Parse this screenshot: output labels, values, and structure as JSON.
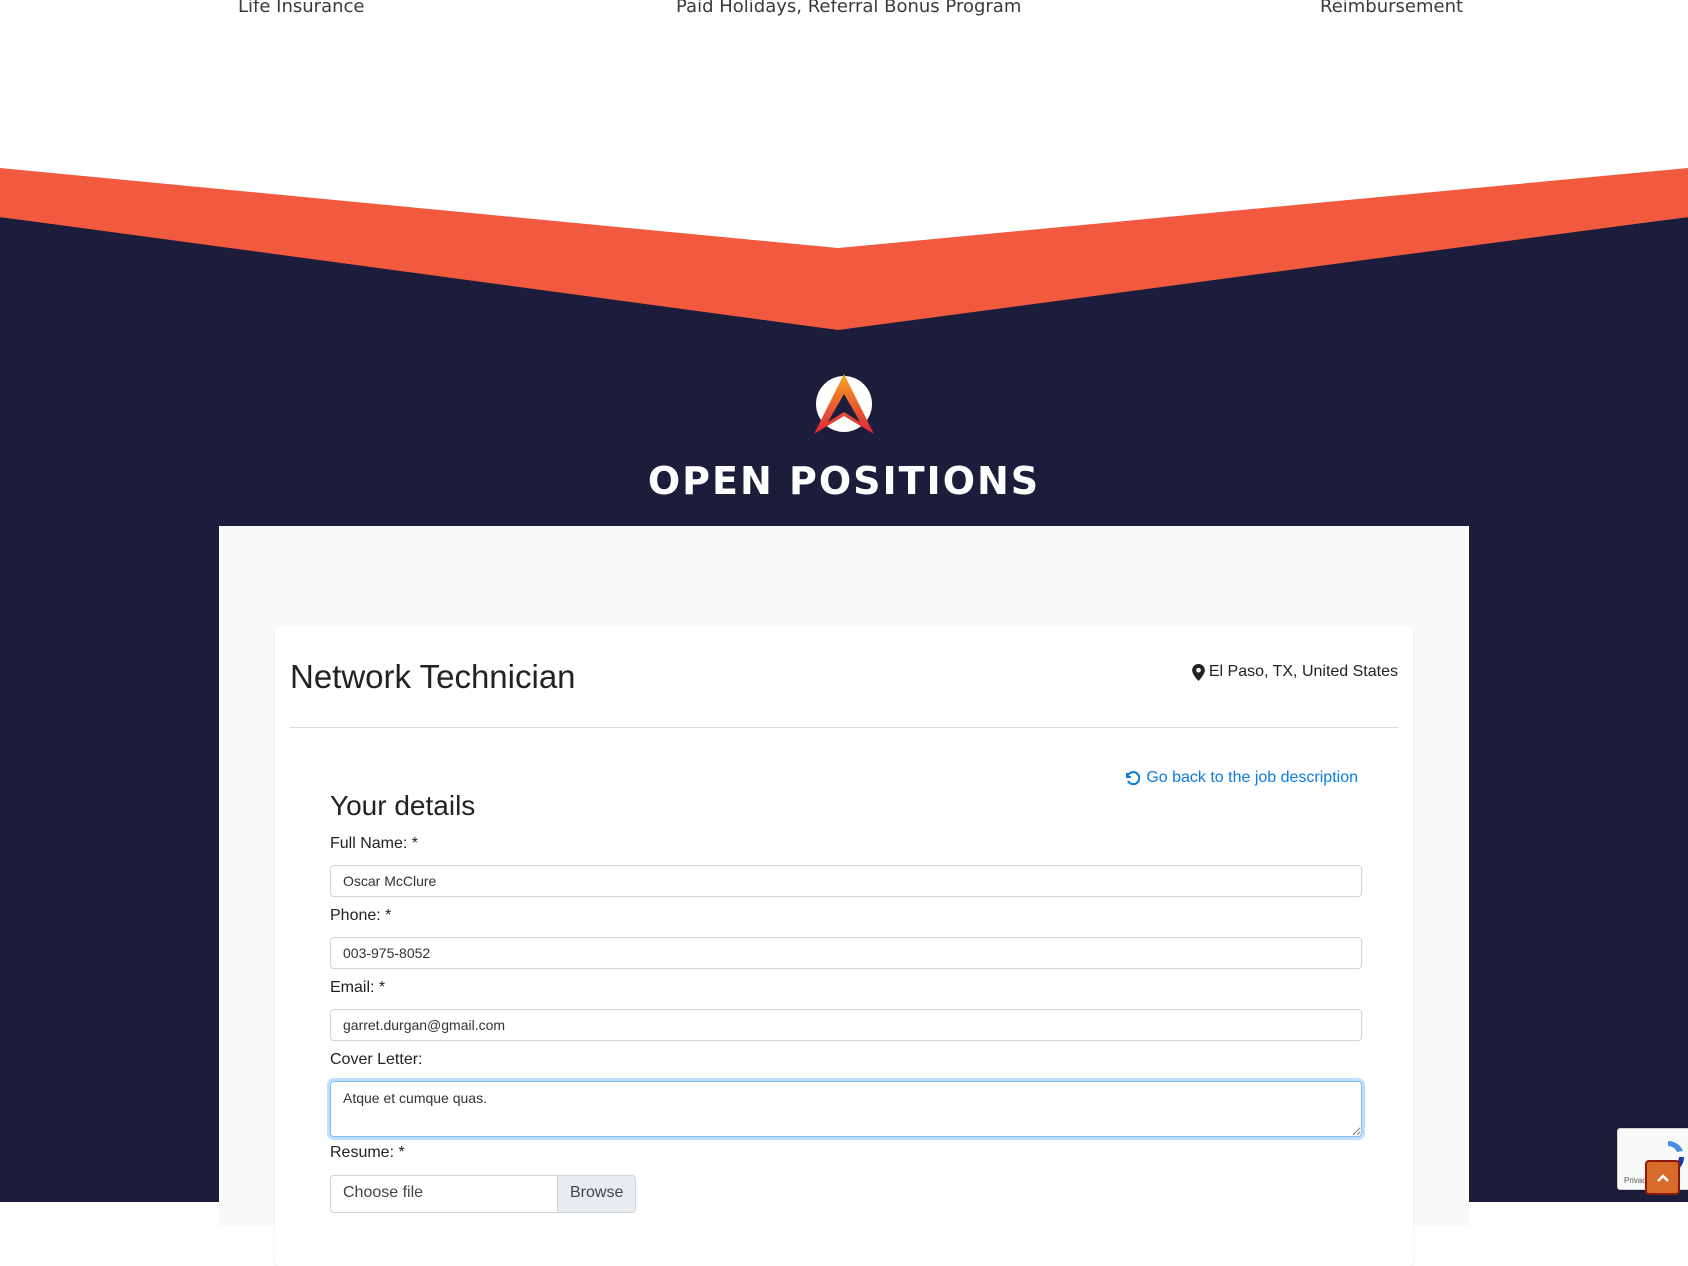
{
  "benefits": [
    "Life Insurance",
    "Paid Holidays, Referral Bonus Program",
    "Reimbursement"
  ],
  "section_title": "OPEN POSITIONS",
  "colors": {
    "accent": "#f25a3f",
    "navy": "#1b1d3b",
    "link": "#0a7ce0"
  },
  "job": {
    "title": "Network Technician",
    "location": "El Paso, TX, United States"
  },
  "form": {
    "back_link": "Go back to the job description",
    "heading": "Your details",
    "full_name_label": "Full Name: *",
    "full_name_value": "Oscar McClure",
    "phone_label": "Phone: *",
    "phone_value": "003-975-8052",
    "email_label": "Email: *",
    "email_value": "garret.durgan@gmail.com",
    "cover_label": "Cover Letter:",
    "cover_value": "Atque et cumque quas.",
    "resume_label": "Resume: *",
    "file_placeholder": "Choose file",
    "browse_label": "Browse"
  },
  "recaptcha": {
    "privacy_text": "Privac"
  }
}
